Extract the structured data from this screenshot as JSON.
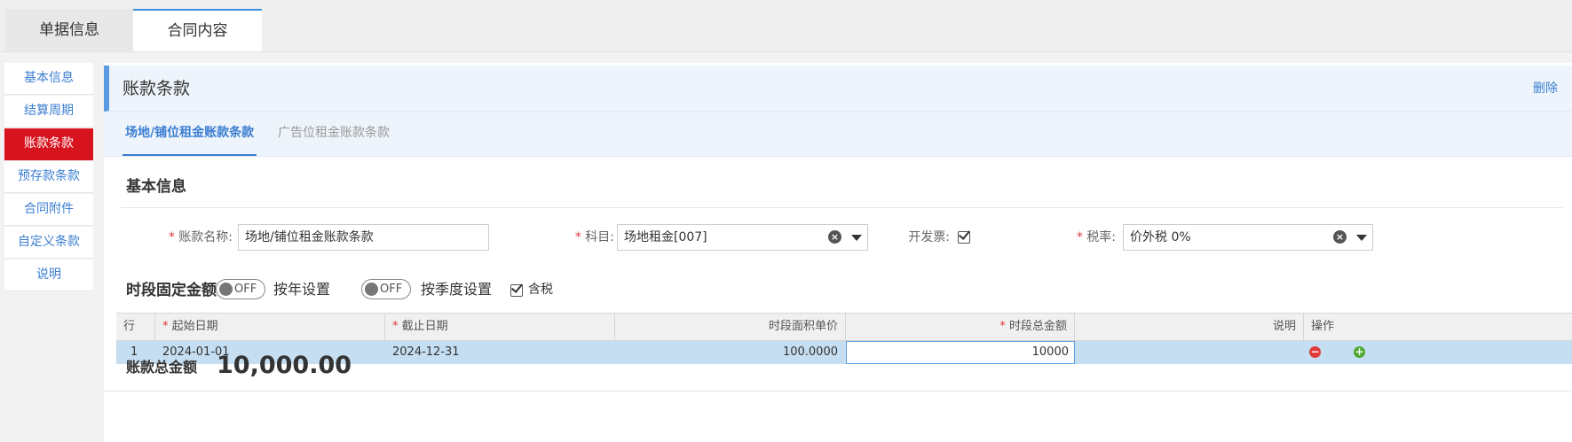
{
  "top_tabs": [
    "单据信息",
    "合同内容"
  ],
  "sidebar": {
    "items": [
      {
        "label": "基本信息"
      },
      {
        "label": "结算周期"
      },
      {
        "label": "账款条款"
      },
      {
        "label": "预存款条款"
      },
      {
        "label": "合同附件"
      },
      {
        "label": "自定义条款"
      },
      {
        "label": "说明"
      }
    ],
    "active": "账款条款"
  },
  "section": {
    "title": "账款条款",
    "delete_label": "删除"
  },
  "sub_tabs": [
    "场地/铺位租金账款条款",
    "广告位租金账款条款"
  ],
  "basic_info": {
    "title": "基本信息",
    "required_mark": "*",
    "name_label": "账款名称:",
    "name_value": "场地/铺位租金账款条款",
    "subject_label": "科目:",
    "subject_value": "场地租金[007]",
    "invoice_label": "开发票:",
    "invoice_checked": true,
    "tax_label": "税率:",
    "tax_value": "价外税 0%"
  },
  "fixed_amount": {
    "title": "时段固定金额",
    "toggle_off_text": "OFF",
    "by_year_label": "按年设置",
    "by_quarter_label": "按季度设置",
    "tax_included_label": "含税",
    "tax_included_checked": true
  },
  "table": {
    "headers": {
      "row": "行",
      "start_date": "起始日期",
      "end_date": "截止日期",
      "unit_price": "时段面积单价",
      "total": "时段总金额",
      "note": "说明",
      "ops": "操作"
    },
    "rows": [
      {
        "row": "1",
        "start_date": "2024-01-01",
        "end_date": "2024-12-31",
        "unit_price": "100.0000",
        "total": "10000",
        "note": ""
      }
    ]
  },
  "summary": {
    "total_label": "账款总金额",
    "total_value": "10,000.00"
  },
  "colors": {
    "accent": "#3b7ed1",
    "active_sidebar": "#d7131e",
    "selected_row": "#c5def1"
  }
}
